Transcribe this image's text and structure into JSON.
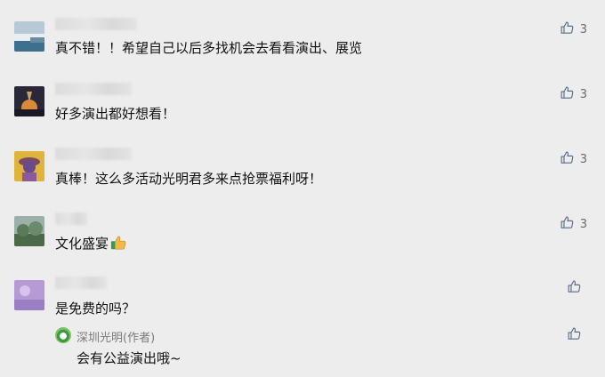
{
  "comments": [
    {
      "text": "真不错！！希望自己以后多找机会去看看演出、展览",
      "likes": "3",
      "avatar": "landscape-avatar"
    },
    {
      "text": "好多演出都好想看！",
      "likes": "3",
      "avatar": "sunset-avatar"
    },
    {
      "text": "真棒！这么多活动光明君多来点抢票福利呀！",
      "likes": "3",
      "avatar": "cartoon-avatar"
    },
    {
      "text": "文化盛宴",
      "likes": "3",
      "avatar": "trees-avatar",
      "emoji": "thumbs-up-emoji"
    },
    {
      "text": "是免费的吗？",
      "likes": "",
      "avatar": "purple-avatar"
    }
  ],
  "reply": {
    "author": "深圳光明(作者)",
    "text": "会有公益演出哦~",
    "likes": ""
  },
  "colors": {
    "background": "#ededed",
    "like_icon": "#5b6b8a"
  }
}
